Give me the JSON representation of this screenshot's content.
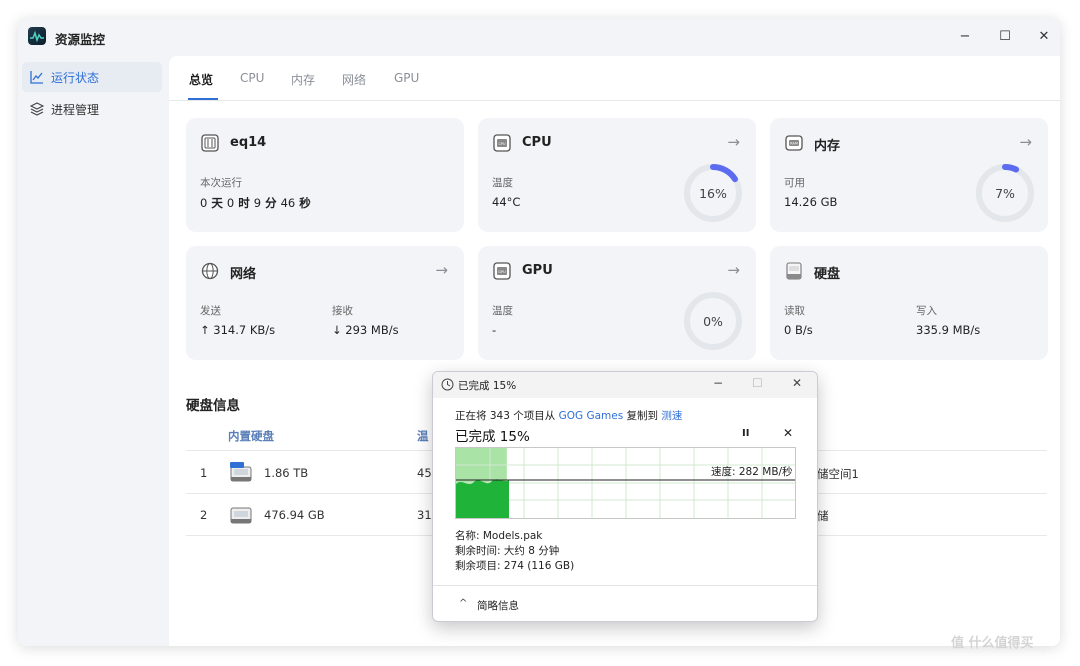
{
  "app": {
    "title": "资源监控"
  },
  "window_controls": {
    "minimize": "−",
    "maximize": "☐",
    "close": "✕"
  },
  "sidebar": {
    "items": [
      {
        "label": "运行状态",
        "icon": "chart-line-icon",
        "active": true
      },
      {
        "label": "进程管理",
        "icon": "layers-icon",
        "active": false
      }
    ]
  },
  "tabs": [
    "总览",
    "CPU",
    "内存",
    "网络",
    "GPU"
  ],
  "cards": {
    "host": {
      "title": "eq14",
      "label": "本次运行",
      "uptime": {
        "d": "0",
        "d_unit": "天",
        "h": "0",
        "h_unit": "时",
        "m": "9",
        "m_unit": "分",
        "s": "46",
        "s_unit": "秒"
      }
    },
    "cpu": {
      "title": "CPU",
      "label": "温度",
      "value": "44°C",
      "percent_text": "16%",
      "percent": 16
    },
    "memory": {
      "title": "内存",
      "label": "可用",
      "value": "14.26 GB",
      "percent_text": "7%",
      "percent": 7
    },
    "network": {
      "title": "网络",
      "send_label": "发送",
      "send_value": "↑ 314.7 KB/s",
      "recv_label": "接收",
      "recv_value": "↓ 293 MB/s"
    },
    "gpu": {
      "title": "GPU",
      "label": "温度",
      "value": "-",
      "percent_text": "0%",
      "percent": 0
    },
    "disk": {
      "title": "硬盘",
      "read_label": "读取",
      "read_value": "0 B/s",
      "write_label": "写入",
      "write_value": "335.9 MB/s"
    },
    "arrow": "→"
  },
  "disk_info": {
    "title": "硬盘信息",
    "headers": {
      "name": "内置硬盘",
      "temp": "温"
    },
    "rows": [
      {
        "index": "1",
        "size": "1.86 TB",
        "temp": "45",
        "extra": "储空间1"
      },
      {
        "index": "2",
        "size": "476.94 GB",
        "temp": "31",
        "extra": "储"
      }
    ]
  },
  "copy_dialog": {
    "title": "已完成 15%",
    "line_prefix": "正在将 343 个项目从 ",
    "source": "GOG Games",
    "line_mid": " 复制到 ",
    "dest": "测速",
    "big_status": "已完成 15%",
    "pause": "II",
    "cancel": "✕",
    "speed": "速度: 282 MB/秒",
    "progress": 0.15,
    "name_line": "名称: Models.pak",
    "time_line": "剩余时间: 大约 8 分钟",
    "items_line": "剩余项目: 274 (116 GB)",
    "details_chevron": "^",
    "details_label": "简略信息",
    "controls": {
      "minimize": "−",
      "maximize": "☐",
      "close": "✕"
    }
  },
  "watermark": "值 什么值得买",
  "colors": {
    "accent": "#2f6fd6",
    "gauge_track": "#e3e6ea",
    "gauge_fill": "#5b6cf0",
    "graph_fill": "#1fb33a",
    "graph_done": "#a9e3a5"
  }
}
